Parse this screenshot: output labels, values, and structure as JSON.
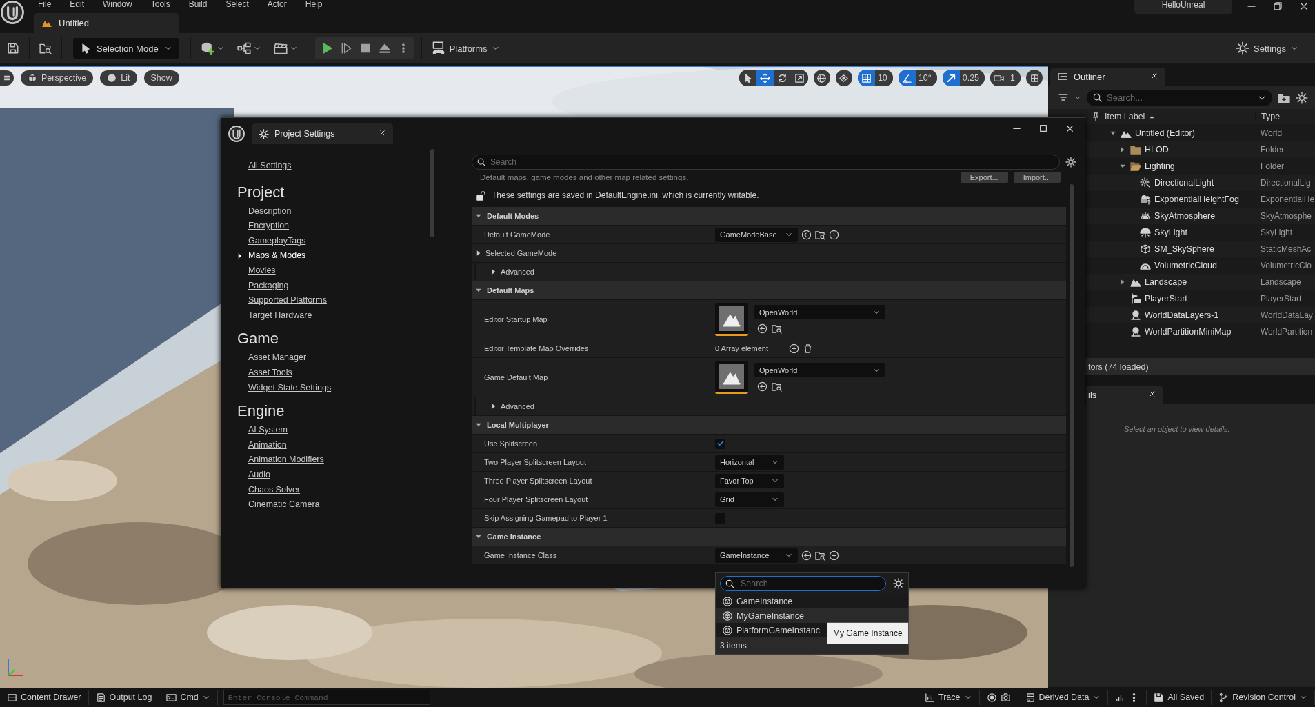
{
  "menu": [
    "File",
    "Edit",
    "Window",
    "Tools",
    "Build",
    "Select",
    "Actor",
    "Help"
  ],
  "level_tab": {
    "label": "Untitled"
  },
  "project_name": "HelloUnreal",
  "toolbar": {
    "mode": "Selection Mode",
    "platforms": "Platforms",
    "settings": "Settings"
  },
  "viewport": {
    "view_buttons": [
      "Perspective",
      "Lit",
      "Show"
    ],
    "transform_tools": [
      {
        "kind": "select",
        "selected": false
      },
      {
        "kind": "move",
        "selected": true
      },
      {
        "kind": "rotate",
        "selected": false
      },
      {
        "kind": "scale",
        "selected": false
      }
    ],
    "snaps": [
      {
        "kind": "grid",
        "on": true,
        "value": "10"
      },
      {
        "kind": "angle",
        "on": true,
        "value": "10°"
      },
      {
        "kind": "scale",
        "on": true,
        "value": "0.25"
      },
      {
        "kind": "camera",
        "on": false,
        "value": "1"
      }
    ]
  },
  "outliner": {
    "title": "Outliner",
    "search_placeholder": "Search...",
    "columns": [
      "Item Label",
      "Type"
    ],
    "tree": [
      {
        "label": "Untitled (Editor)",
        "type": "World",
        "kind": "world",
        "expanded": true,
        "children": [
          {
            "label": "HLOD",
            "type": "Folder",
            "kind": "folder",
            "expanded": false
          },
          {
            "label": "Lighting",
            "type": "Folder",
            "kind": "folder",
            "expanded": true,
            "children": [
              {
                "label": "DirectionalLight",
                "type": "DirectionalLig",
                "kind": "sun"
              },
              {
                "label": "ExponentialHeightFog",
                "type": "ExponentialHe",
                "kind": "fog"
              },
              {
                "label": "SkyAtmosphere",
                "type": "SkyAtmosphe",
                "kind": "atmosphere"
              },
              {
                "label": "SkyLight",
                "type": "SkyLight",
                "kind": "skylight"
              },
              {
                "label": "SM_SkySphere",
                "type": "StaticMeshAc",
                "kind": "mesh"
              },
              {
                "label": "VolumetricCloud",
                "type": "VolumetricClo",
                "kind": "cloud"
              }
            ]
          },
          {
            "label": "Landscape",
            "type": "Landscape",
            "kind": "landscape",
            "expanded": false
          },
          {
            "label": "PlayerStart",
            "type": "PlayerStart",
            "kind": "playerstart"
          },
          {
            "label": "WorldDataLayers-1",
            "type": "WorldDataLay",
            "kind": "datalayer"
          },
          {
            "label": "WorldPartitionMiniMap",
            "type": "WorldPartition",
            "kind": "datalayer"
          }
        ]
      }
    ],
    "actor_count": "tors (74 loaded)"
  },
  "details": {
    "title": "ils",
    "message": "Select an object to view details."
  },
  "project_settings": {
    "title": "Project Settings",
    "all_settings": "All Settings",
    "groups": [
      {
        "heading": "Project",
        "items": [
          {
            "label": "Description",
            "selected": false
          },
          {
            "label": "Encryption",
            "selected": false
          },
          {
            "label": "GameplayTags",
            "selected": false
          },
          {
            "label": "Maps & Modes",
            "selected": true
          },
          {
            "label": "Movies",
            "selected": false
          },
          {
            "label": "Packaging",
            "selected": false
          },
          {
            "label": "Supported Platforms",
            "selected": false
          },
          {
            "label": "Target Hardware",
            "selected": false
          }
        ]
      },
      {
        "heading": "Game",
        "items": [
          {
            "label": "Asset Manager",
            "selected": false
          },
          {
            "label": "Asset Tools",
            "selected": false
          },
          {
            "label": "Widget State Settings",
            "selected": false
          }
        ]
      },
      {
        "heading": "Engine",
        "items": [
          {
            "label": "AI System",
            "selected": false
          },
          {
            "label": "Animation",
            "selected": false
          },
          {
            "label": "Animation Modifiers",
            "selected": false
          },
          {
            "label": "Audio",
            "selected": false
          },
          {
            "label": "Chaos Solver",
            "selected": false
          },
          {
            "label": "Cinematic Camera",
            "selected": false
          }
        ]
      }
    ],
    "search_placeholder": "Search",
    "description": "Default maps, game modes and other map related settings.",
    "actions": [
      "Export...",
      "Import..."
    ],
    "writable_note": "These settings are saved in DefaultEngine.ini, which is currently writable.",
    "sections": [
      {
        "title": "Default Modes",
        "expanded": true,
        "rows": [
          {
            "kind": "class",
            "label": "Default GameMode",
            "value": "GameModeBase"
          },
          {
            "kind": "group",
            "label": "Selected GameMode",
            "expanded": false
          },
          {
            "kind": "advanced",
            "label": "Advanced",
            "expanded": false
          }
        ]
      },
      {
        "title": "Default Maps",
        "expanded": true,
        "rows": [
          {
            "kind": "map",
            "label": "Editor Startup Map",
            "value": "OpenWorld"
          },
          {
            "kind": "array",
            "label": "Editor Template Map Overrides",
            "value": "0 Array element"
          },
          {
            "kind": "map",
            "label": "Game Default Map",
            "value": "OpenWorld"
          },
          {
            "kind": "advanced",
            "label": "Advanced",
            "expanded": false
          }
        ]
      },
      {
        "title": "Local Multiplayer",
        "expanded": true,
        "rows": [
          {
            "kind": "checkbox",
            "label": "Use Splitscreen",
            "checked": true
          },
          {
            "kind": "combo",
            "label": "Two Player Splitscreen Layout",
            "value": "Horizontal"
          },
          {
            "kind": "combo",
            "label": "Three Player Splitscreen Layout",
            "value": "Favor Top"
          },
          {
            "kind": "combo",
            "label": "Four Player Splitscreen Layout",
            "value": "Grid"
          },
          {
            "kind": "checkbox",
            "label": "Skip Assigning Gamepad to Player 1",
            "checked": false
          }
        ]
      },
      {
        "title": "Game Instance",
        "expanded": true,
        "rows": [
          {
            "kind": "class",
            "label": "Game Instance Class",
            "value": "GameInstance"
          }
        ]
      }
    ]
  },
  "class_picker": {
    "search_placeholder": "Search",
    "items": [
      {
        "label": "GameInstance",
        "hovered": false
      },
      {
        "label": "MyGameInstance",
        "hovered": true
      },
      {
        "label": "PlatformGameInstanc",
        "hovered": false
      }
    ],
    "count": "3 items",
    "tooltip": "My Game Instance"
  },
  "status_bar": {
    "left": [
      {
        "kind": "drawer",
        "label": "Content Drawer"
      },
      {
        "kind": "log",
        "label": "Output Log"
      },
      {
        "kind": "cmd",
        "label": "Cmd"
      }
    ],
    "console_placeholder": "Enter Console Command",
    "right": [
      {
        "kind": "trace",
        "label": "Trace"
      },
      {
        "kind": "derived",
        "label": "Derived Data"
      },
      {
        "kind": "saved",
        "label": "All Saved"
      },
      {
        "kind": "revision",
        "label": "Revision Control"
      }
    ]
  }
}
